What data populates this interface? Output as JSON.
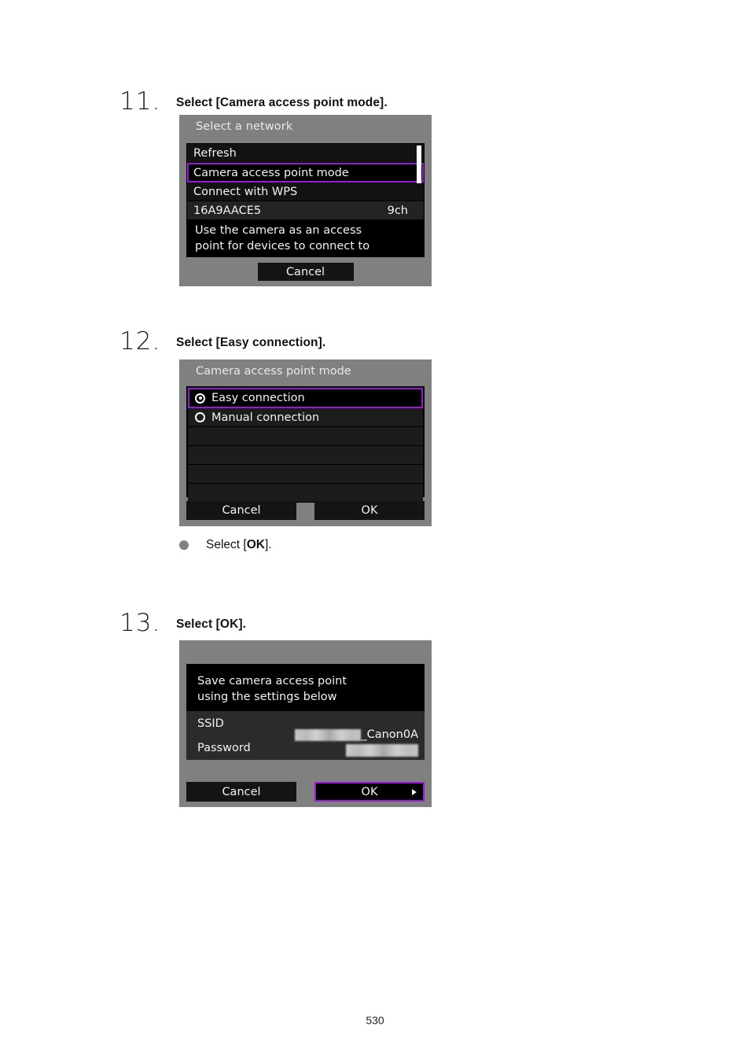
{
  "document": {
    "page_number": "530"
  },
  "steps": [
    {
      "number": "11.",
      "title": "Select [Camera access point mode]."
    },
    {
      "number": "12.",
      "title": "Select [Easy connection]."
    },
    {
      "number": "13.",
      "title": "Select [OK]."
    }
  ],
  "bullet": {
    "prefix": "Select [",
    "bold": "OK",
    "suffix": "]."
  },
  "screen1": {
    "title": "Select a network",
    "rows": [
      {
        "label": "Refresh",
        "value": "",
        "selected": false
      },
      {
        "label": "Camera access point mode",
        "value": "",
        "selected": true
      },
      {
        "label": "Connect with WPS",
        "value": "",
        "selected": false
      },
      {
        "label": "16A9AACE5",
        "value": "9ch",
        "selected": false
      }
    ],
    "description_line1": "Use the camera as an access",
    "description_line2": "point for devices to connect to",
    "cancel_label": "Cancel"
  },
  "screen2": {
    "title": "Camera access point mode",
    "options": [
      {
        "label": "Easy connection",
        "checked": true,
        "selected": true
      },
      {
        "label": "Manual connection",
        "checked": false,
        "selected": false
      }
    ],
    "blank_row_count": 4,
    "cancel_label": "Cancel",
    "ok_label": "OK"
  },
  "screen3": {
    "message_line1": "Save camera access point",
    "message_line2": "using the settings below",
    "ssid_label": "SSID",
    "ssid_redacted": true,
    "ssid_suffix": "_Canon0A",
    "password_label": "Password",
    "password_redacted": true,
    "cancel_label": "Cancel",
    "ok_label": "OK"
  },
  "colors": {
    "highlight": "#9B16D6",
    "screen_background": "#808080",
    "list_background": "#1b1b1b",
    "text": "#f2f2f2"
  }
}
